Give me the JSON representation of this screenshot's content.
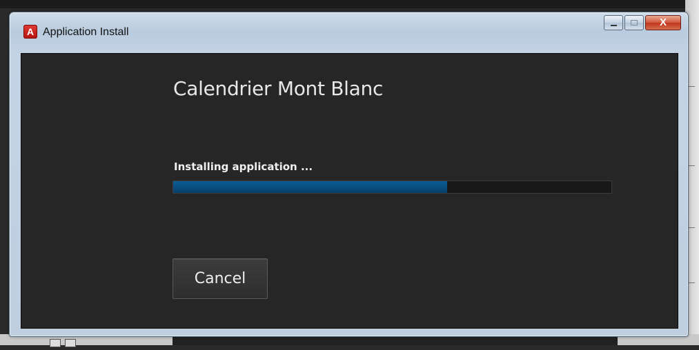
{
  "window": {
    "title": "Application Install",
    "icon": "adobe-air-icon",
    "icon_glyph": "A",
    "controls": {
      "minimize": "minimize-icon",
      "maximize": "maximize-icon",
      "close": "close-icon",
      "close_glyph": "X"
    }
  },
  "installer": {
    "app_name": "Calendrier Mont Blanc",
    "status": "Installing application ...",
    "progress": 0.625,
    "cancel_label": "Cancel"
  },
  "colors": {
    "progress_fill": "#0a5a92",
    "client_bg": "#262626",
    "title_icon": "#c8201b"
  }
}
